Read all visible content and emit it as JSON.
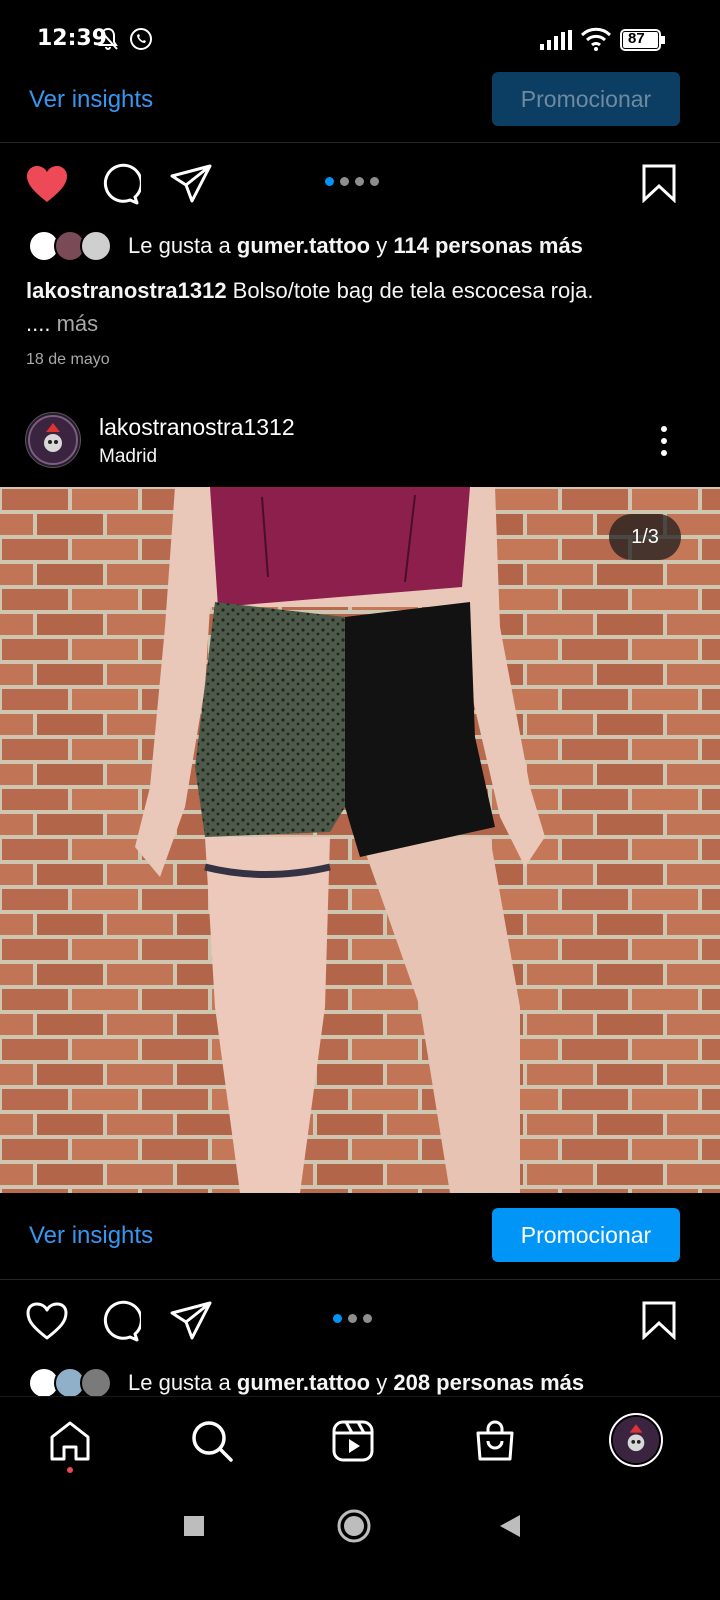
{
  "status_bar": {
    "time": "12:39",
    "battery": "87"
  },
  "post1": {
    "insights_label": "Ver insights",
    "promote_label": "Promocionar",
    "likes_prefix": "Le gusta a ",
    "likes_user": "gumer.tattoo",
    "likes_join": " y ",
    "likes_others": "114 personas más",
    "caption_user": "lakostranostra1312",
    "caption_text": " Bolso/tote bag de tela escocesa roja.",
    "caption_ellipsis": "....",
    "caption_more": " más",
    "date": "18 de mayo",
    "liked": true
  },
  "post2": {
    "username": "lakostranostra1312",
    "location": "Madrid",
    "image_counter": "1/3",
    "insights_label": "Ver insights",
    "promote_label": "Promocionar",
    "likes_prefix": "Le gusta a ",
    "likes_user": "gumer.tattoo",
    "likes_join": " y ",
    "likes_others": "208 personas más",
    "liked": false
  },
  "icons": {
    "status": [
      "mute-icon",
      "whatsapp-icon",
      "signal-icon",
      "wifi-icon",
      "battery-icon"
    ],
    "actions": [
      "heart-icon",
      "comment-icon",
      "share-icon",
      "bookmark-icon"
    ],
    "nav": [
      "home-icon",
      "search-icon",
      "reels-icon",
      "shop-icon",
      "profile-avatar"
    ],
    "system": [
      "recents-icon",
      "home-circle-icon",
      "back-icon"
    ]
  },
  "colors": {
    "accent": "#0095f6",
    "link": "#3797f0",
    "like_red": "#ed4956",
    "background": "#000000"
  }
}
